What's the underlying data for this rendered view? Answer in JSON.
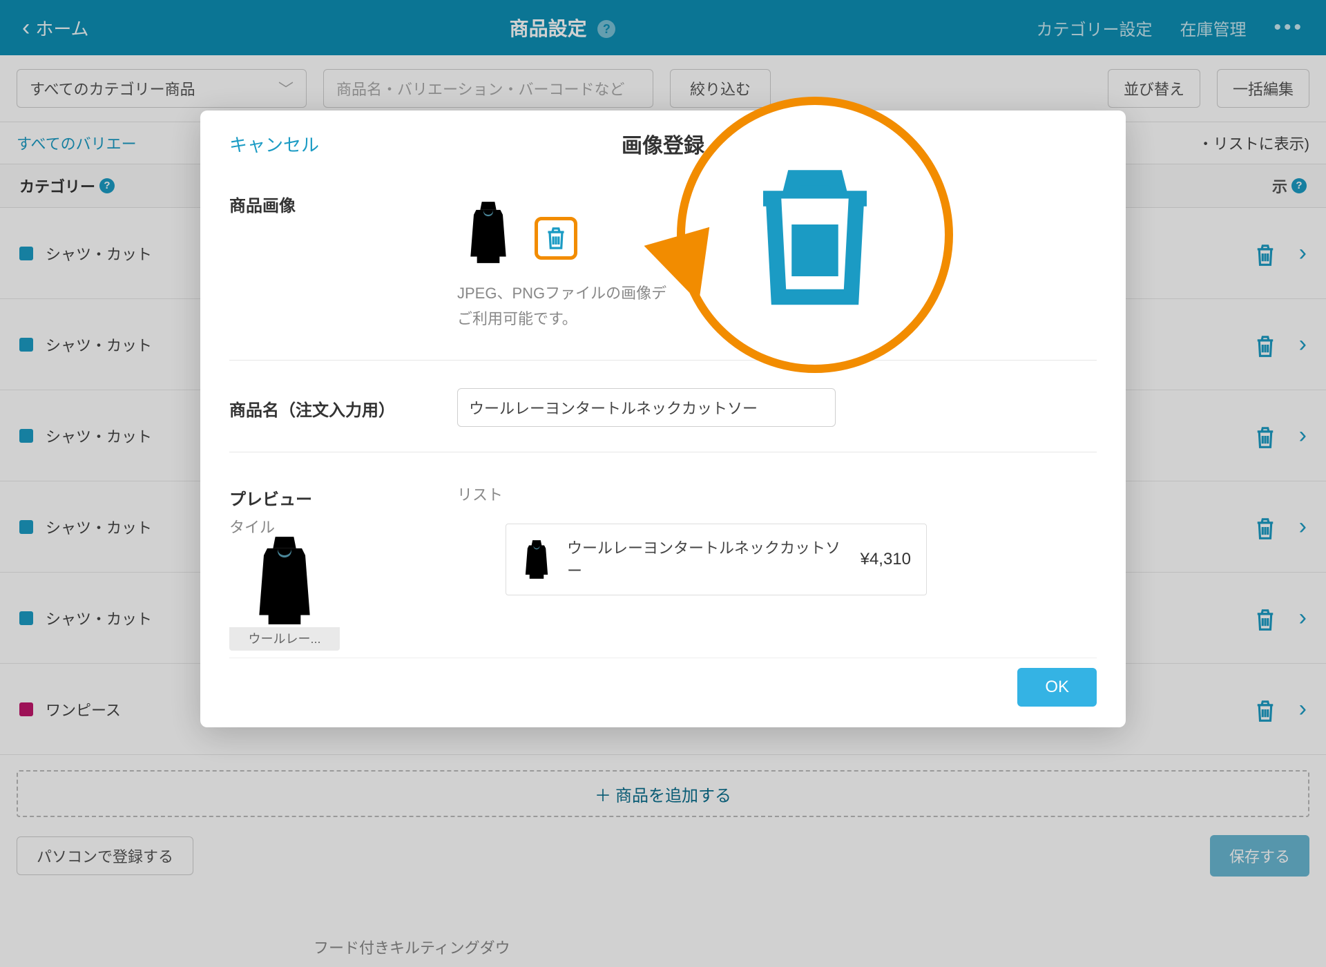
{
  "nav": {
    "back": "ホーム",
    "title": "商品設定",
    "cat_settings": "カテゴリー設定",
    "stock": "在庫管理"
  },
  "filter": {
    "select": "すべてのカテゴリー商品",
    "search_placeholder": "商品名・バリエーション・バーコードなど",
    "narrow": "絞り込む",
    "sort": "並び替え",
    "bulk": "一括編集"
  },
  "sub": {
    "left": "すべてのバリエー",
    "right_suffix": "・リストに表示)"
  },
  "thead": {
    "category": "カテゴリー",
    "display": "示"
  },
  "rows": [
    {
      "name": "シャツ・カット",
      "color": "blue"
    },
    {
      "name": "シャツ・カット",
      "color": "blue"
    },
    {
      "name": "シャツ・カット",
      "color": "blue"
    },
    {
      "name": "シャツ・カット",
      "color": "blue"
    },
    {
      "name": "シャツ・カット",
      "color": "blue"
    },
    {
      "name": "ワンピース",
      "color": "pink"
    }
  ],
  "add_label": "商品を追加する",
  "pc_register": "パソコンで登録する",
  "save": "保存する",
  "bg_tile_caption": "フード付きキルティングダウ",
  "modal": {
    "cancel": "キャンセル",
    "title": "画像登録",
    "sec1_label": "商品画像",
    "sec1_help1": "JPEG、PNGファイルの画像デ",
    "sec1_help2": "ご利用可能です。",
    "sec2_label": "商品名（注文入力用）",
    "product_name": "ウールレーヨンタートルネックカットソー",
    "sec3_label": "プレビュー",
    "sub_tile": "タイル",
    "sub_list": "リスト",
    "tile_caption": "ウールレー...",
    "list_name": "ウールレーヨンタートルネックカットソー",
    "price": "¥4,310",
    "ok": "OK"
  }
}
